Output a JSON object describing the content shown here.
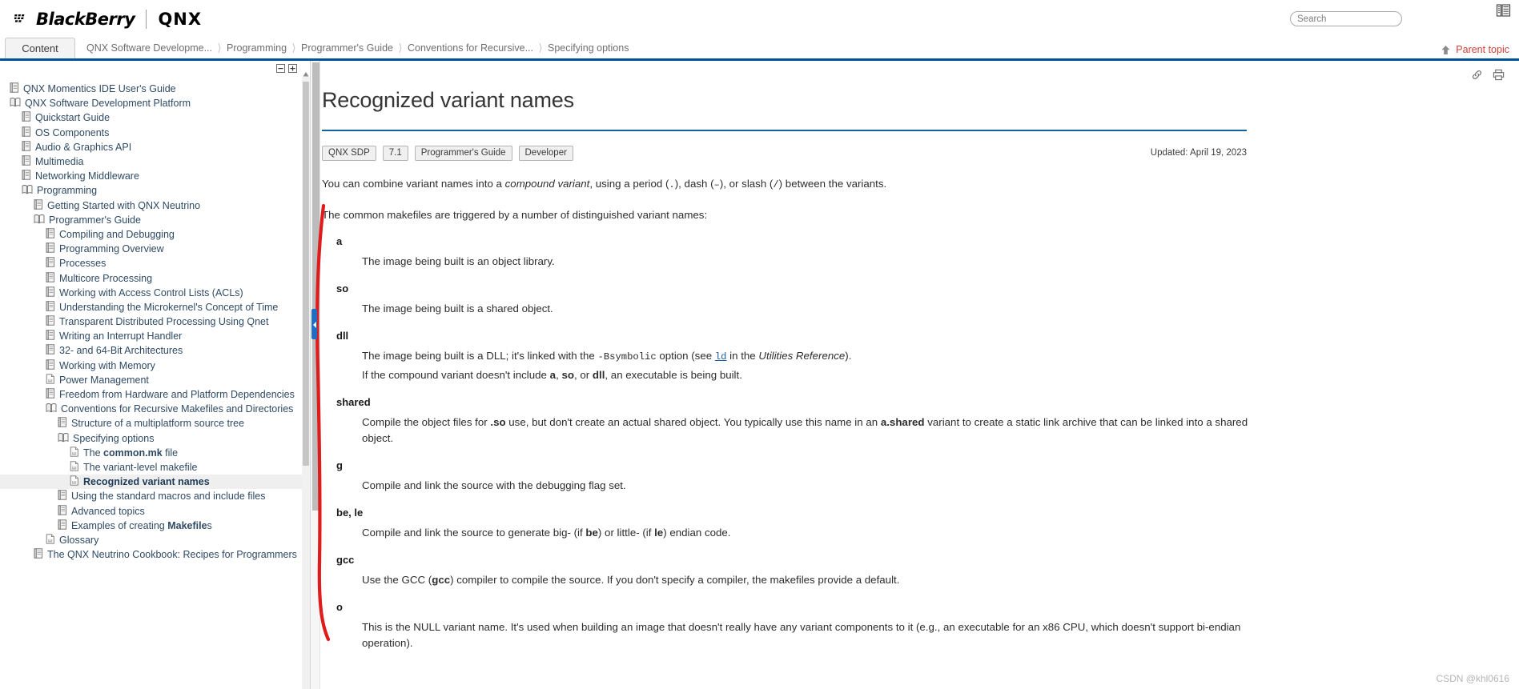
{
  "header": {
    "brand_blackberry": "BlackBerry",
    "brand_qnx": "QNX",
    "search_placeholder": "Search",
    "search_value": "",
    "toc_toggle_icon": "toc-panel-icon"
  },
  "navbar": {
    "content_tab": "Content",
    "breadcrumbs": [
      "QNX Software Developme...",
      "Programming",
      "Programmer's Guide",
      "Conventions for Recursive...",
      "Specifying options"
    ],
    "parent_topic": "Parent topic",
    "parent_topic_icon": "up-arrow-icon",
    "accent_color": "#00539b"
  },
  "sidebar": {
    "collapse_all_icon": "collapse-all-icon",
    "expand_all_icon": "expand-all-icon",
    "tree": [
      {
        "label": "QNX Momentics IDE User's Guide",
        "icon": "book-closed-icon",
        "depth": 0,
        "selected": false
      },
      {
        "label": "QNX Software Development Platform",
        "icon": "book-open-icon",
        "depth": 0,
        "selected": false
      },
      {
        "label": "Quickstart Guide",
        "icon": "book-closed-icon",
        "depth": 1,
        "selected": false
      },
      {
        "label": "OS Components",
        "icon": "book-closed-icon",
        "depth": 1,
        "selected": false
      },
      {
        "label": "Audio & Graphics API",
        "icon": "book-closed-icon",
        "depth": 1,
        "selected": false
      },
      {
        "label": "Multimedia",
        "icon": "book-closed-icon",
        "depth": 1,
        "selected": false
      },
      {
        "label": "Networking Middleware",
        "icon": "book-closed-icon",
        "depth": 1,
        "selected": false
      },
      {
        "label": "Programming",
        "icon": "book-open-icon",
        "depth": 1,
        "selected": false
      },
      {
        "label": "Getting Started with QNX Neutrino",
        "icon": "book-closed-icon",
        "depth": 2,
        "selected": false
      },
      {
        "label": "Programmer's Guide",
        "icon": "book-open-icon",
        "depth": 2,
        "selected": false
      },
      {
        "label": "Compiling and Debugging",
        "icon": "book-closed-icon",
        "depth": 3,
        "selected": false
      },
      {
        "label": "Programming Overview",
        "icon": "book-closed-icon",
        "depth": 3,
        "selected": false
      },
      {
        "label": "Processes",
        "icon": "book-closed-icon",
        "depth": 3,
        "selected": false
      },
      {
        "label": "Multicore Processing",
        "icon": "book-closed-icon",
        "depth": 3,
        "selected": false
      },
      {
        "label": "Working with Access Control Lists (ACLs)",
        "icon": "book-closed-icon",
        "depth": 3,
        "selected": false
      },
      {
        "label": "Understanding the Microkernel's Concept of Time",
        "icon": "book-closed-icon",
        "depth": 3,
        "selected": false
      },
      {
        "label": "Transparent Distributed Processing Using Qnet",
        "icon": "book-closed-icon",
        "depth": 3,
        "selected": false
      },
      {
        "label": "Writing an Interrupt Handler",
        "icon": "book-closed-icon",
        "depth": 3,
        "selected": false
      },
      {
        "label": "32- and 64-Bit Architectures",
        "icon": "book-closed-icon",
        "depth": 3,
        "selected": false
      },
      {
        "label": "Working with Memory",
        "icon": "book-closed-icon",
        "depth": 3,
        "selected": false
      },
      {
        "label": "Power Management",
        "icon": "page-icon",
        "depth": 3,
        "selected": false
      },
      {
        "label": "Freedom from Hardware and Platform Dependencies",
        "icon": "book-closed-icon",
        "depth": 3,
        "selected": false
      },
      {
        "label": "Conventions for Recursive Makefiles and Directories",
        "icon": "book-open-icon",
        "depth": 3,
        "selected": false
      },
      {
        "label": "Structure of a multiplatform source tree",
        "icon": "book-closed-icon",
        "depth": 4,
        "selected": false
      },
      {
        "label": "Specifying options",
        "icon": "book-open-icon",
        "depth": 4,
        "selected": false
      },
      {
        "label": "The common.mk file",
        "icon": "page-icon",
        "depth": 5,
        "selected": false,
        "bold_part": "common.mk",
        "prefix": "The ",
        "suffix": " file"
      },
      {
        "label": "The variant-level makefile",
        "icon": "page-icon",
        "depth": 5,
        "selected": false
      },
      {
        "label": "Recognized variant names",
        "icon": "page-icon",
        "depth": 5,
        "selected": true
      },
      {
        "label": "Using the standard macros and include files",
        "icon": "book-closed-icon",
        "depth": 4,
        "selected": false
      },
      {
        "label": "Advanced topics",
        "icon": "book-closed-icon",
        "depth": 4,
        "selected": false
      },
      {
        "label": "Examples of creating Makefiles",
        "icon": "book-closed-icon",
        "depth": 4,
        "selected": false,
        "prefix": "Examples of creating ",
        "bold_part": "Makefile",
        "suffix": "s"
      },
      {
        "label": "Glossary",
        "icon": "page-icon",
        "depth": 3,
        "selected": false
      },
      {
        "label": "The QNX Neutrino Cookbook: Recipes for Programmers",
        "icon": "book-closed-icon",
        "depth": 2,
        "selected": false
      }
    ]
  },
  "content": {
    "title": "Recognized variant names",
    "share_icon": "link-icon",
    "print_icon": "printer-icon",
    "tags": [
      "QNX SDP",
      "7.1",
      "Programmer's Guide",
      "Developer"
    ],
    "updated": "Updated: April 19, 2023",
    "intro_1": {
      "a": "You can combine variant names into a ",
      "em": "compound variant",
      "b": ", using a period (",
      "code1": ".",
      "c": "), dash (",
      "code2": "–",
      "d": "), or slash (",
      "code3": "/",
      "e": ") between the variants."
    },
    "intro_2": "The common makefiles are triggered by a number of distinguished variant names:",
    "definitions": [
      {
        "term": "a",
        "lines": [
          {
            "text": "The image being built is an object library."
          }
        ]
      },
      {
        "term": "so",
        "lines": [
          {
            "text": "The image being built is a shared object."
          }
        ]
      },
      {
        "term": "dll",
        "lines": [
          {
            "pre": "The image being built is a DLL; it's linked with the ",
            "code": "-Bsymbolic",
            "mid": " option (see ",
            "link": "ld",
            "post_a": " in the ",
            "em": "Utilities Reference",
            "post_b": ")."
          },
          {
            "pre2": "If the compound variant doesn't include ",
            "b1": "a",
            "sep1": ", ",
            "b2": "so",
            "sep2": ", or ",
            "b3": "dll",
            "post2": ", an executable is being built."
          }
        ]
      },
      {
        "term": "shared",
        "lines": [
          {
            "pre": "Compile the object files for ",
            "b1": ".so",
            "mid": " use, but don't create an actual shared object. You typically use this name in an ",
            "b2": "a.shared",
            "post": " variant to create a static link archive that can be linked into a shared object."
          }
        ]
      },
      {
        "term": "g",
        "lines": [
          {
            "text": "Compile and link the source with the debugging flag set."
          }
        ]
      },
      {
        "term": "be, le",
        "lines": [
          {
            "pre": "Compile and link the source to generate big- (if ",
            "b1": "be",
            "mid": ") or little- (if ",
            "b2": "le",
            "post": ") endian code."
          }
        ]
      },
      {
        "term": "gcc",
        "lines": [
          {
            "pre": "Use the GCC (",
            "b1": "gcc",
            "post": ") compiler to compile the source. If you don't specify a compiler, the makefiles provide a default."
          }
        ]
      },
      {
        "term": "o",
        "lines": [
          {
            "text": "This is the NULL variant name. It's used when building an image that doesn't really have any variant components to it (e.g., an executable for an x86 CPU, which doesn't support bi-endian operation)."
          }
        ]
      }
    ],
    "annotation": {
      "shape": "red-bracket-line",
      "color": "#e01b1b"
    }
  },
  "watermark": "CSDN @khl0616"
}
